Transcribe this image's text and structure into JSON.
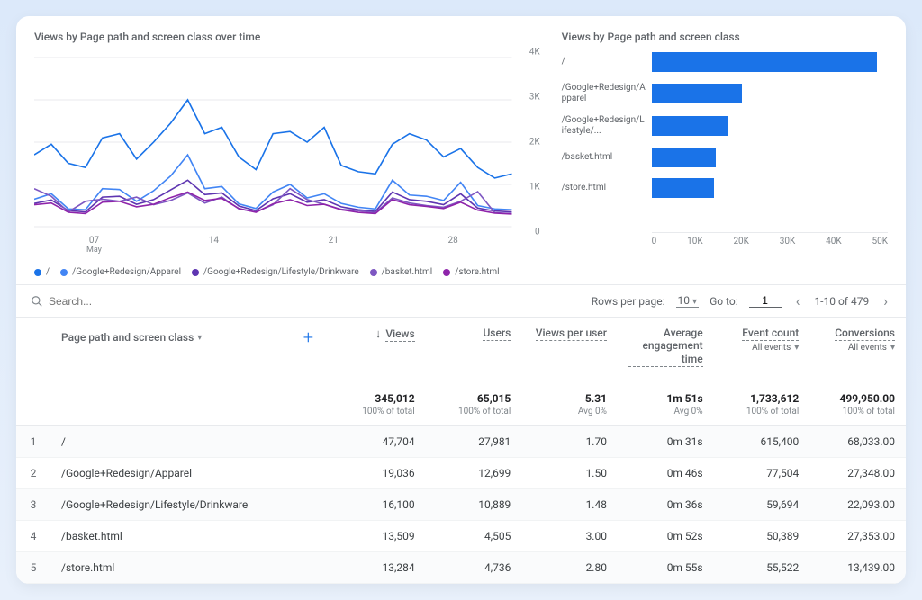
{
  "chart_data": [
    {
      "type": "line",
      "title": "Views by Page path and screen class over time",
      "ylabel": "",
      "ylim": [
        0,
        4000
      ],
      "yticks": [
        0,
        "1K",
        "2K",
        "3K",
        "4K"
      ],
      "xticks": [
        "07",
        "14",
        "21",
        "28"
      ],
      "xsub": "May",
      "series": [
        {
          "name": "/",
          "color": "#1a73e8",
          "values": [
            1700,
            1950,
            1500,
            1400,
            2100,
            2200,
            1600,
            2000,
            2450,
            3000,
            2200,
            2350,
            1650,
            1350,
            2200,
            2250,
            2000,
            2350,
            1450,
            1300,
            1250,
            1950,
            2200,
            2050,
            1650,
            1850,
            1400,
            1150,
            1250
          ]
        },
        {
          "name": "/Google+Redesign/Apparel",
          "color": "#4285f4",
          "values": [
            650,
            780,
            420,
            400,
            900,
            880,
            600,
            850,
            1200,
            1700,
            900,
            950,
            540,
            430,
            820,
            1000,
            680,
            780,
            550,
            460,
            420,
            1100,
            750,
            720,
            620,
            1050,
            500,
            420,
            400
          ]
        },
        {
          "name": "/Google+Redesign/Lifestyle/Drinkware",
          "color": "#5e35b1",
          "values": [
            550,
            630,
            380,
            350,
            700,
            720,
            530,
            640,
            870,
            1100,
            760,
            800,
            490,
            380,
            660,
            780,
            580,
            640,
            470,
            400,
            360,
            820,
            640,
            600,
            520,
            780,
            440,
            370,
            350
          ]
        },
        {
          "name": "/basket.html",
          "color": "#7e57c2",
          "values": [
            900,
            720,
            350,
            600,
            650,
            600,
            700,
            520,
            620,
            800,
            560,
            700,
            420,
            350,
            520,
            900,
            640,
            530,
            410,
            380,
            330,
            680,
            560,
            500,
            460,
            600,
            830,
            330,
            310
          ]
        },
        {
          "name": "/store.html",
          "color": "#8e24aa",
          "values": [
            520,
            560,
            340,
            310,
            580,
            600,
            470,
            530,
            690,
            820,
            620,
            670,
            430,
            340,
            540,
            640,
            500,
            530,
            400,
            340,
            310,
            640,
            520,
            480,
            430,
            580,
            390,
            320,
            300
          ]
        }
      ]
    },
    {
      "type": "bar",
      "orientation": "horizontal",
      "title": "Views by Page path and screen class",
      "xlim": [
        0,
        50000
      ],
      "xticks": [
        "0",
        "10K",
        "20K",
        "30K",
        "40K",
        "50K"
      ],
      "categories": [
        "/",
        "/Google+Redesign/Apparel",
        "/Google+Redesign/Lifestyle/...",
        "/basket.html",
        "/store.html"
      ],
      "values": [
        47704,
        19036,
        16100,
        13509,
        13284
      ],
      "color": "#1a73e8"
    }
  ],
  "search": {
    "placeholder": "Search..."
  },
  "pagination": {
    "rows_label": "Rows per page:",
    "rows_value": "10",
    "goto_label": "Go to:",
    "goto_value": "1",
    "range": "1-10 of 479"
  },
  "columns": {
    "dim_header": "Page path and screen class",
    "views": "Views",
    "users": "Users",
    "vpu": "Views per user",
    "aet": "Average engagement time",
    "event": "Event count",
    "event_sub": "All events",
    "conv": "Conversions",
    "conv_sub": "All events"
  },
  "totals": {
    "views": "345,012",
    "users": "65,015",
    "vpu": "5.31",
    "aet": "1m 51s",
    "event": "1,733,612",
    "conv": "499,950.00",
    "subs": {
      "views": "100% of total",
      "users": "100% of total",
      "vpu": "Avg 0%",
      "aet": "Avg 0%",
      "event": "100% of total",
      "conv": "100% of total"
    }
  },
  "rows": [
    {
      "n": "1",
      "path": "/",
      "views": "47,704",
      "users": "27,981",
      "vpu": "1.70",
      "aet": "0m 31s",
      "event": "615,400",
      "conv": "68,033.00"
    },
    {
      "n": "2",
      "path": "/Google+Redesign/Apparel",
      "views": "19,036",
      "users": "12,699",
      "vpu": "1.50",
      "aet": "0m 46s",
      "event": "77,504",
      "conv": "27,348.00"
    },
    {
      "n": "3",
      "path": "/Google+Redesign/Lifestyle/Drinkware",
      "views": "16,100",
      "users": "10,889",
      "vpu": "1.48",
      "aet": "0m 36s",
      "event": "59,694",
      "conv": "22,093.00"
    },
    {
      "n": "4",
      "path": "/basket.html",
      "views": "13,509",
      "users": "4,505",
      "vpu": "3.00",
      "aet": "0m 52s",
      "event": "50,389",
      "conv": "27,353.00"
    },
    {
      "n": "5",
      "path": "/store.html",
      "views": "13,284",
      "users": "4,736",
      "vpu": "2.80",
      "aet": "0m 55s",
      "event": "55,522",
      "conv": "13,439.00"
    }
  ]
}
